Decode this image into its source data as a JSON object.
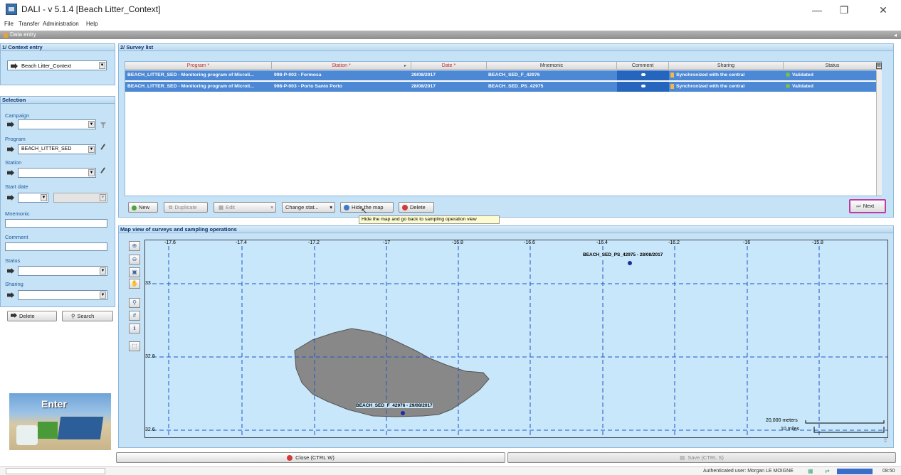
{
  "window": {
    "title": "DALI - v 5.1.4 [Beach Litter_Context]",
    "controls": {
      "minimize": "—",
      "maximize": "❐",
      "close": "✕"
    }
  },
  "menu": [
    "File",
    "Transfer",
    "Administration",
    "Help"
  ],
  "data_entry_label": "Data entry",
  "context_entry": {
    "header": "1/ Context entry",
    "selected_context": "Beach Litter_Context"
  },
  "selection": {
    "header": "Selection",
    "campaign_label": "Campaign",
    "campaign_value": "",
    "program_label": "Program",
    "program_value": "BEACH_LITTER_SED",
    "station_label": "Station",
    "station_value": "",
    "start_date_label": "Start date",
    "mnemonic_label": "Mnemonic",
    "comment_label": "Comment",
    "status_label": "Status",
    "sharing_label": "Sharing",
    "delete_button": "Delete",
    "search_button": "Search"
  },
  "enter_image_text": "Enter",
  "survey_list": {
    "header": "2/ Survey list",
    "columns": [
      "Program *",
      "Station *",
      "Date *",
      "Mnemonic",
      "Comment",
      "Sharing",
      "Status"
    ],
    "rows": [
      {
        "program": "BEACH_LITTER_SED - Monitoring program of Microli...",
        "station": "998-P-002 - Formosa",
        "date": "29/08/2017",
        "mnemonic": "BEACH_SED_F_42976",
        "sharing": "Synchronized with the central",
        "status": "Validated"
      },
      {
        "program": "BEACH_LITTER_SED - Monitoring program of Microli...",
        "station": "998-P-003 - Porto Santo Porto",
        "date": "28/08/2017",
        "mnemonic": "BEACH_SED_PS_42975",
        "sharing": "Synchronized with the central",
        "status": "Validated"
      }
    ]
  },
  "toolbar": {
    "new": "New",
    "duplicate": "Duplicate",
    "edit": "Edit",
    "change_status": "Change stat...",
    "hide_map": "Hide the map",
    "delete": "Delete",
    "next": "Next",
    "tooltip": "Hide the map and go back to sampling operation view"
  },
  "map_view": {
    "header": "Map view of surveys and sampling operations",
    "lon_labels": [
      "-17.6",
      "-17.4",
      "-17.2",
      "-17",
      "-16.8",
      "-16.6",
      "-16.4",
      "-16.2",
      "-16",
      "-15.8"
    ],
    "lat_labels": [
      "33",
      "32.8",
      "32.6"
    ],
    "markers": [
      "BEACH_SED_PS_42975 - 28/08/2017",
      "BEACH_SED_F_42976 - 29/08/2017"
    ],
    "scale_meters": "20,000 meters",
    "scale_miles": "10 miles",
    "tools": [
      "zoom-in",
      "zoom-out",
      "zoom-extent",
      "pan",
      "zoom-layer",
      "grid",
      "info",
      "select"
    ]
  },
  "bottom_buttons": {
    "close": "Close (CTRL W)",
    "save": "Save (CTRL S)"
  },
  "status_bar": {
    "user": "Authenticated user: Morgan LE MOIGNE",
    "time": "08:50"
  },
  "colors": {
    "panel": "#c6e2f6",
    "selected_row": "#4c88d4",
    "land": "#888888",
    "water": "#c8e7fa"
  }
}
